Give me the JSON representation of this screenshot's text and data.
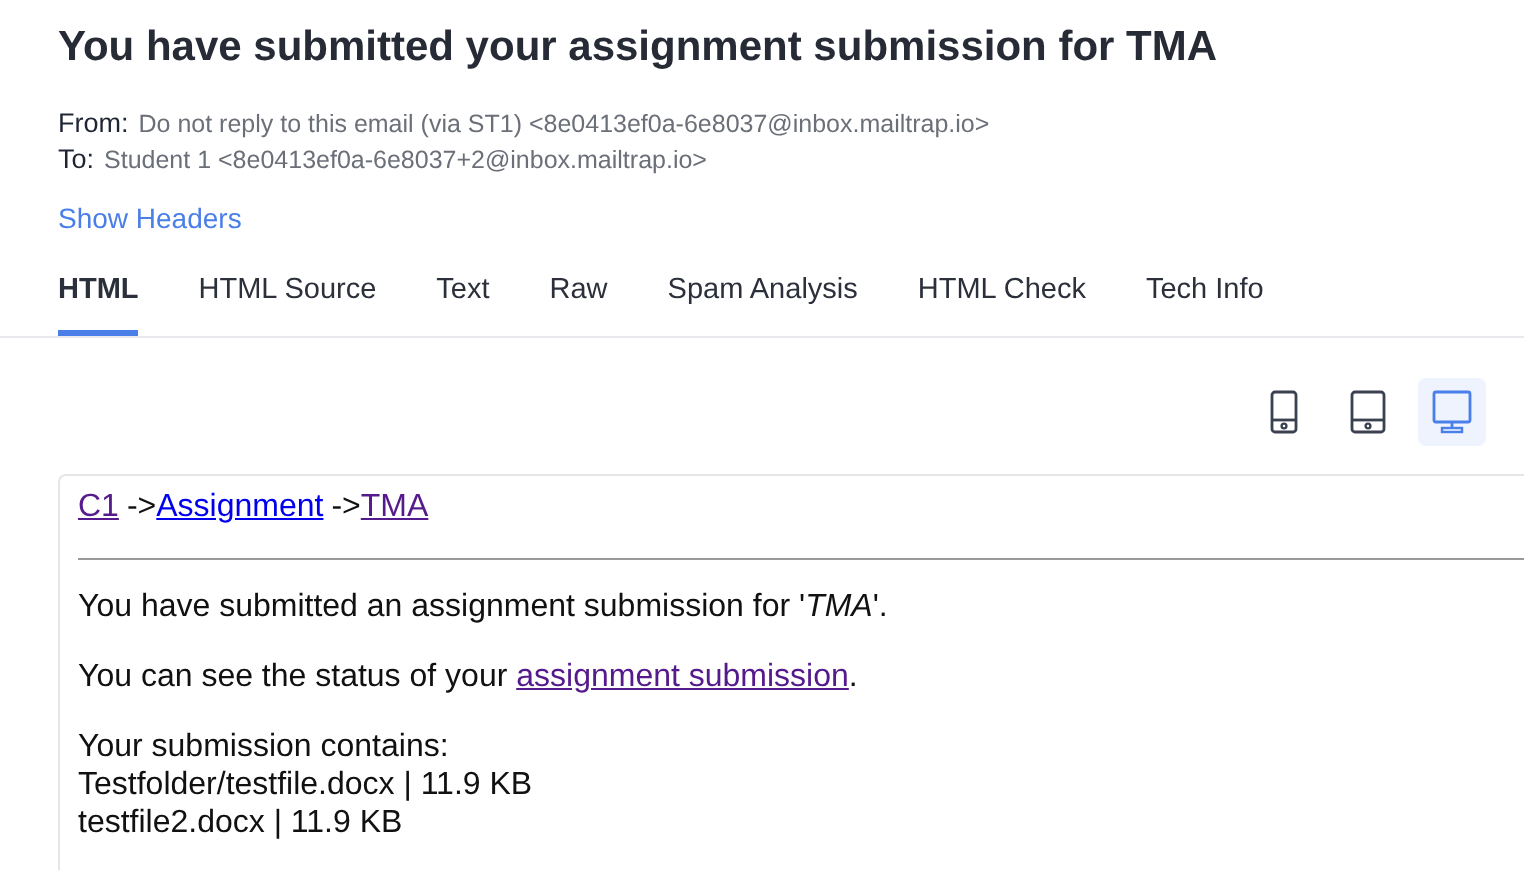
{
  "email": {
    "subject": "You have submitted your assignment submission for TMA",
    "from_label": "From:",
    "from": "Do not reply to this email (via ST1) <8e0413ef0a-6e8037@inbox.mailtrap.io>",
    "to_label": "To:",
    "to": "Student 1 <8e0413ef0a-6e8037+2@inbox.mailtrap.io>",
    "show_headers": "Show Headers"
  },
  "tabs": [
    {
      "label": "HTML",
      "selected": true
    },
    {
      "label": "HTML Source",
      "selected": false
    },
    {
      "label": "Text",
      "selected": false
    },
    {
      "label": "Raw",
      "selected": false
    },
    {
      "label": "Spam Analysis",
      "selected": false
    },
    {
      "label": "HTML Check",
      "selected": false
    },
    {
      "label": "Tech Info",
      "selected": false
    }
  ],
  "devices": [
    {
      "kind": "mobile",
      "selected": false
    },
    {
      "kind": "tablet",
      "selected": false
    },
    {
      "kind": "desktop",
      "selected": true
    }
  ],
  "body": {
    "breadcrumb": [
      {
        "kind": "link",
        "text": "C1",
        "visited": true
      },
      {
        "kind": "text",
        "text": "->"
      },
      {
        "kind": "link",
        "text": "Assignment",
        "visited": false
      },
      {
        "kind": "text",
        "text": "->"
      },
      {
        "kind": "link",
        "text": "TMA",
        "visited": true
      }
    ],
    "message": "You have submitted an assignment submission for '*TMA*'.",
    "status_before": "You can see the status of your",
    "status_link": {
      "text": "assignment submission",
      "visited": true
    },
    "status_after": ".",
    "contents_label": "Your submission contains:",
    "files": [
      "Testfolder/testfile.docx | 11.9 KB",
      "testfile2.docx | 11.9 KB"
    ]
  }
}
